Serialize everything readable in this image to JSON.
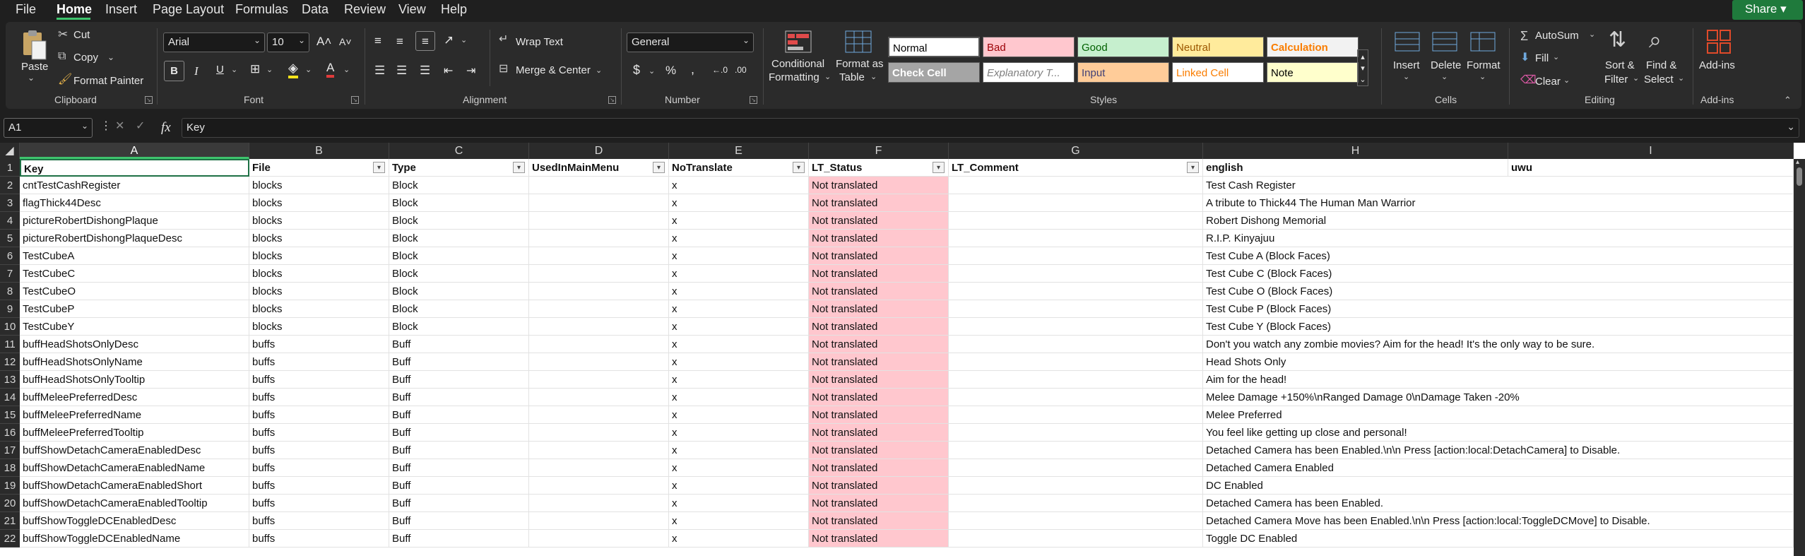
{
  "tabs": [
    "File",
    "Home",
    "Insert",
    "Page Layout",
    "Formulas",
    "Data",
    "Review",
    "View",
    "Help"
  ],
  "share": "Share",
  "clipboard": {
    "paste": "Paste",
    "cut": "Cut",
    "copy": "Copy",
    "format_painter": "Format Painter",
    "label": "Clipboard"
  },
  "font": {
    "name": "Arial",
    "size": "10",
    "label": "Font"
  },
  "alignment": {
    "wrap": "Wrap Text",
    "merge": "Merge & Center",
    "label": "Alignment"
  },
  "number": {
    "format": "General",
    "label": "Number"
  },
  "styles": {
    "conditional1": "Conditional",
    "conditional2": "Formatting",
    "format_as1": "Format as",
    "format_as2": "Table",
    "label": "Styles",
    "cells": [
      {
        "text": "Normal",
        "bg": "#ffffff",
        "fg": "#000000"
      },
      {
        "text": "Bad",
        "bg": "#ffc7ce",
        "fg": "#9c0006"
      },
      {
        "text": "Good",
        "bg": "#c6efce",
        "fg": "#006100"
      },
      {
        "text": "Neutral",
        "bg": "#ffeb9c",
        "fg": "#9c5700"
      },
      {
        "text": "Calculation",
        "bg": "#f2f2f2",
        "fg": "#fa7d00"
      },
      {
        "text": "Check Cell",
        "bg": "#a5a5a5",
        "fg": "#ffffff"
      },
      {
        "text": "Explanatory T...",
        "bg": "#ffffff",
        "fg": "#7f7f7f"
      },
      {
        "text": "Input",
        "bg": "#ffcc99",
        "fg": "#3f3f76"
      },
      {
        "text": "Linked Cell",
        "bg": "#ffffff",
        "fg": "#fa7d00"
      },
      {
        "text": "Note",
        "bg": "#ffffcc",
        "fg": "#000000"
      }
    ]
  },
  "cells_group": {
    "insert": "Insert",
    "delete": "Delete",
    "format": "Format",
    "label": "Cells"
  },
  "editing": {
    "autosum": "AutoSum",
    "fill": "Fill",
    "clear": "Clear",
    "sort1": "Sort &",
    "sort2": "Filter",
    "find1": "Find &",
    "find2": "Select",
    "label": "Editing"
  },
  "addins": {
    "btn": "Add-ins",
    "label": "Add-ins"
  },
  "formula_bar": {
    "name_box": "A1",
    "fx": "fx",
    "content": "Key"
  },
  "columns": [
    "A",
    "B",
    "C",
    "D",
    "E",
    "F",
    "G",
    "H",
    "I"
  ],
  "headers": [
    "Key",
    "File",
    "Type",
    "UsedInMainMenu",
    "NoTranslate",
    "LT_Status",
    "LT_Comment",
    "english",
    "uwu"
  ],
  "rows": [
    {
      "n": "2",
      "key": "cntTestCashRegister",
      "file": "blocks",
      "type": "Block",
      "nt": "x",
      "status": "Not translated",
      "en": "Test Cash Register"
    },
    {
      "n": "3",
      "key": "flagThick44Desc",
      "file": "blocks",
      "type": "Block",
      "nt": "x",
      "status": "Not translated",
      "en": "A tribute to Thick44 The Human Man Warrior"
    },
    {
      "n": "4",
      "key": "pictureRobertDishongPlaque",
      "file": "blocks",
      "type": "Block",
      "nt": "x",
      "status": "Not translated",
      "en": "Robert Dishong Memorial"
    },
    {
      "n": "5",
      "key": "pictureRobertDishongPlaqueDesc",
      "file": "blocks",
      "type": "Block",
      "nt": "x",
      "status": "Not translated",
      "en": "R.I.P. Kinyajuu"
    },
    {
      "n": "6",
      "key": "TestCubeA",
      "file": "blocks",
      "type": "Block",
      "nt": "x",
      "status": "Not translated",
      "en": "Test Cube A (Block Faces)"
    },
    {
      "n": "7",
      "key": "TestCubeC",
      "file": "blocks",
      "type": "Block",
      "nt": "x",
      "status": "Not translated",
      "en": "Test Cube C (Block Faces)"
    },
    {
      "n": "8",
      "key": "TestCubeO",
      "file": "blocks",
      "type": "Block",
      "nt": "x",
      "status": "Not translated",
      "en": "Test Cube O (Block Faces)"
    },
    {
      "n": "9",
      "key": "TestCubeP",
      "file": "blocks",
      "type": "Block",
      "nt": "x",
      "status": "Not translated",
      "en": "Test Cube P (Block Faces)"
    },
    {
      "n": "10",
      "key": "TestCubeY",
      "file": "blocks",
      "type": "Block",
      "nt": "x",
      "status": "Not translated",
      "en": "Test Cube Y (Block Faces)"
    },
    {
      "n": "11",
      "key": "buffHeadShotsOnlyDesc",
      "file": "buffs",
      "type": "Buff",
      "nt": "x",
      "status": "Not translated",
      "en": "Don't you watch any zombie movies? Aim for the head! It's the only way to be sure."
    },
    {
      "n": "12",
      "key": "buffHeadShotsOnlyName",
      "file": "buffs",
      "type": "Buff",
      "nt": "x",
      "status": "Not translated",
      "en": "Head Shots Only"
    },
    {
      "n": "13",
      "key": "buffHeadShotsOnlyTooltip",
      "file": "buffs",
      "type": "Buff",
      "nt": "x",
      "status": "Not translated",
      "en": "Aim for the head!"
    },
    {
      "n": "14",
      "key": "buffMeleePreferredDesc",
      "file": "buffs",
      "type": "Buff",
      "nt": "x",
      "status": "Not translated",
      "en": "Melee Damage +150%\\nRanged Damage 0\\nDamage Taken -20%"
    },
    {
      "n": "15",
      "key": "buffMeleePreferredName",
      "file": "buffs",
      "type": "Buff",
      "nt": "x",
      "status": "Not translated",
      "en": "Melee Preferred"
    },
    {
      "n": "16",
      "key": "buffMeleePreferredTooltip",
      "file": "buffs",
      "type": "Buff",
      "nt": "x",
      "status": "Not translated",
      "en": "You feel like getting up close and personal!"
    },
    {
      "n": "17",
      "key": "buffShowDetachCameraEnabledDesc",
      "file": "buffs",
      "type": "Buff",
      "nt": "x",
      "status": "Not translated",
      "en": "Detached Camera has been Enabled.\\n\\n Press [action:local:DetachCamera] to Disable."
    },
    {
      "n": "18",
      "key": "buffShowDetachCameraEnabledName",
      "file": "buffs",
      "type": "Buff",
      "nt": "x",
      "status": "Not translated",
      "en": "Detached Camera Enabled"
    },
    {
      "n": "19",
      "key": "buffShowDetachCameraEnabledShort",
      "file": "buffs",
      "type": "Buff",
      "nt": "x",
      "status": "Not translated",
      "en": "DC Enabled"
    },
    {
      "n": "20",
      "key": "buffShowDetachCameraEnabledTooltip",
      "file": "buffs",
      "type": "Buff",
      "nt": "x",
      "status": "Not translated",
      "en": "Detached Camera has been Enabled."
    },
    {
      "n": "21",
      "key": "buffShowToggleDCEnabledDesc",
      "file": "buffs",
      "type": "Buff",
      "nt": "x",
      "status": "Not translated",
      "en": "Detached Camera Move has been Enabled.\\n\\n Press [action:local:ToggleDCMove] to Disable."
    },
    {
      "n": "22",
      "key": "buffShowToggleDCEnabledName",
      "file": "buffs",
      "type": "Buff",
      "nt": "x",
      "status": "Not translated",
      "en": "Toggle DC Enabled"
    }
  ]
}
